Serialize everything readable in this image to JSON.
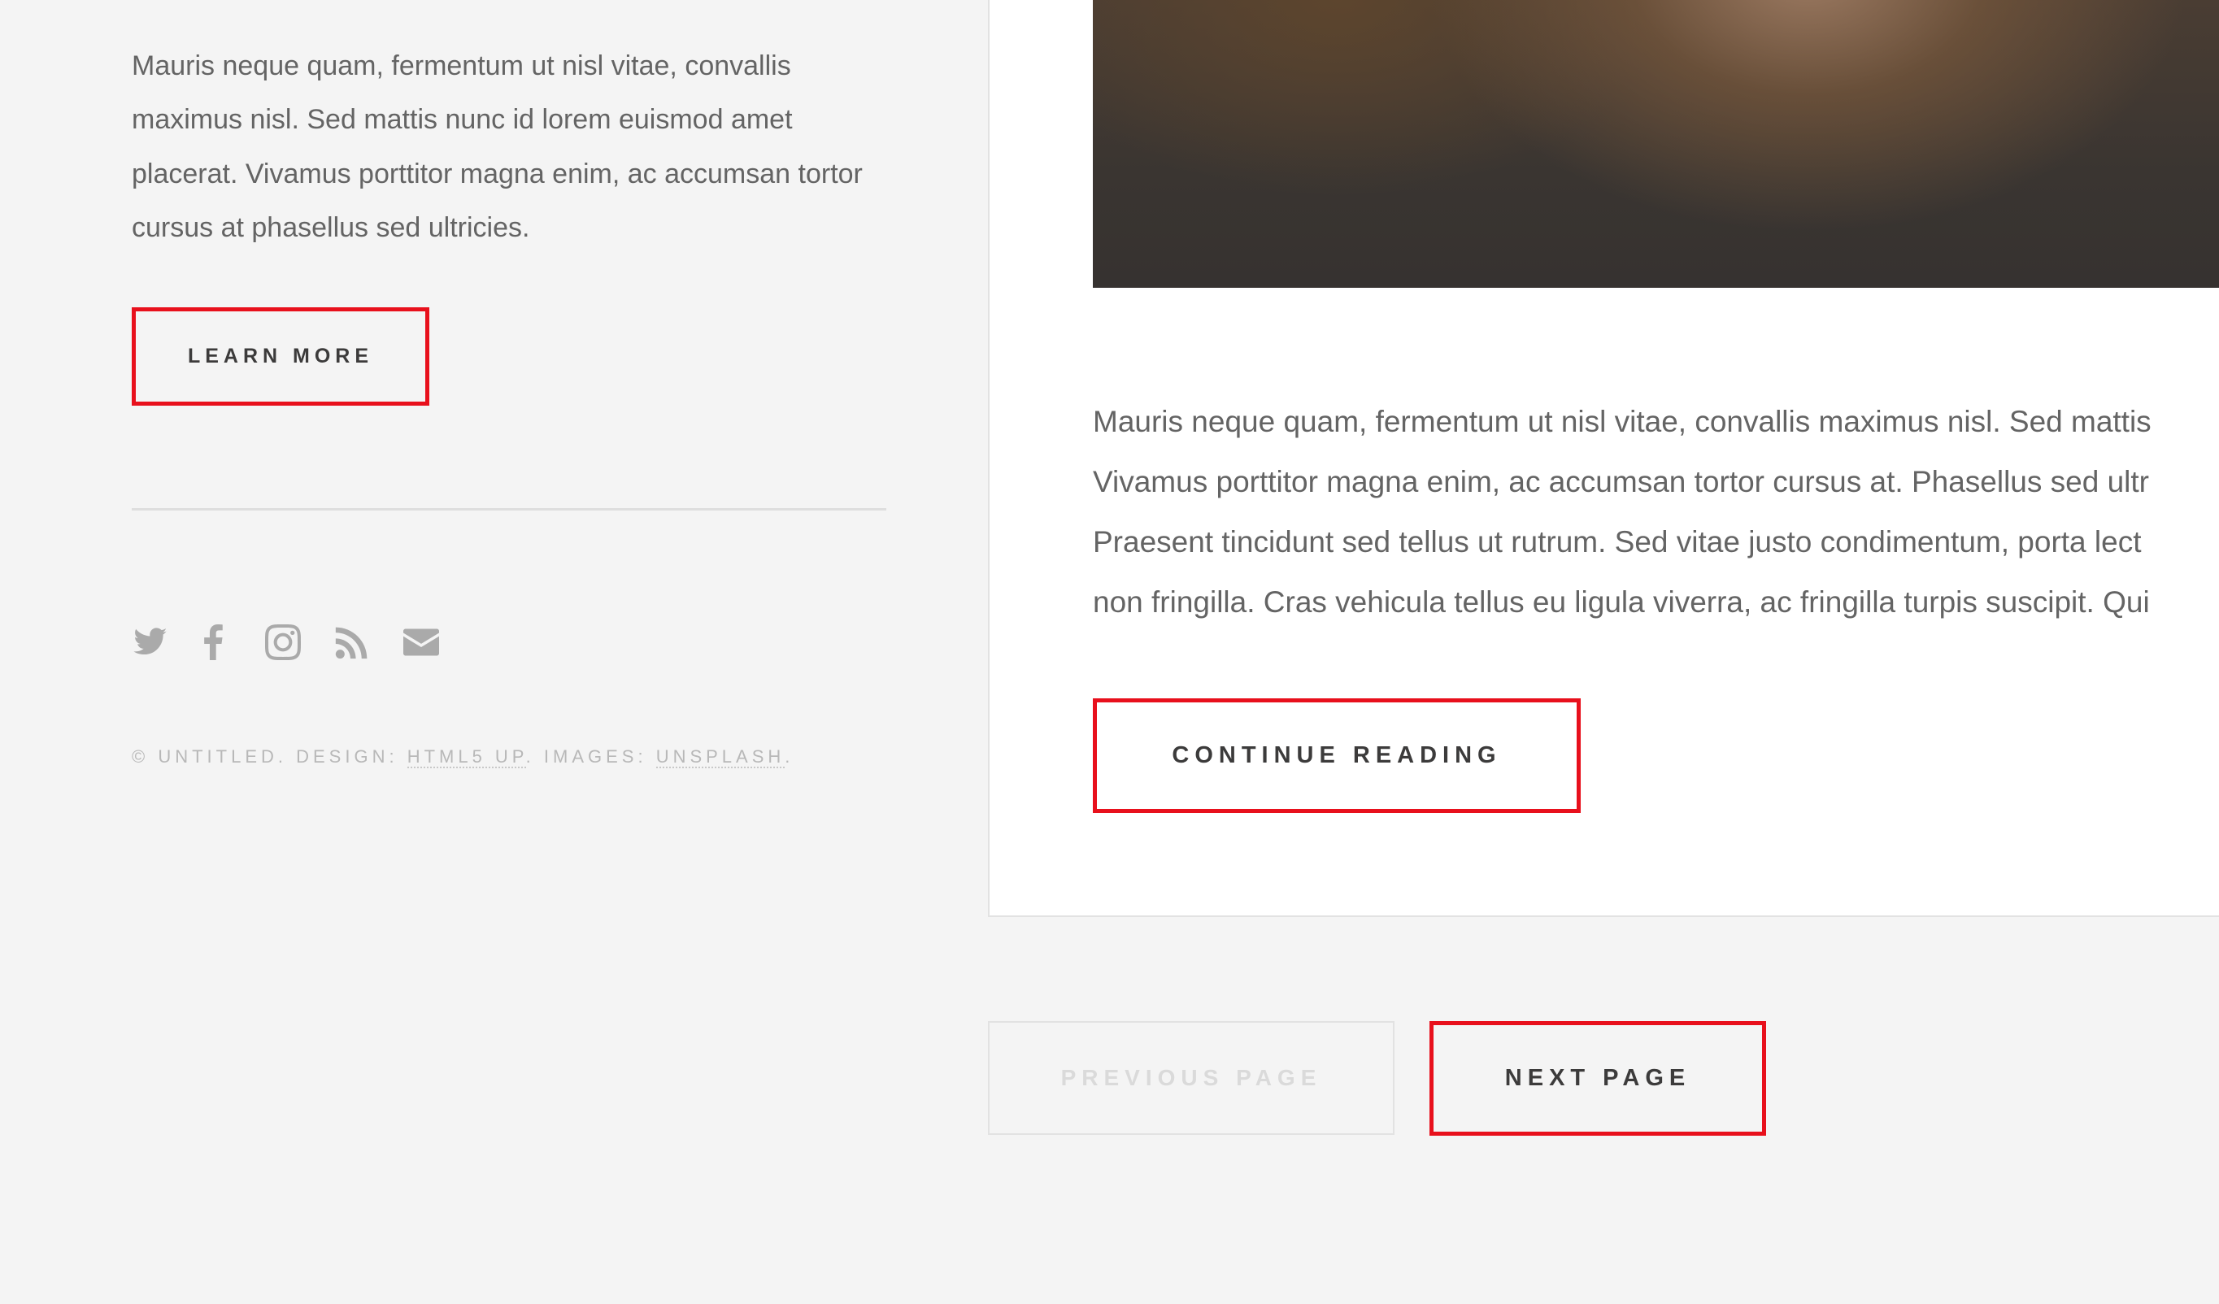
{
  "sidebar": {
    "intro_text": "Mauris neque quam, fermentum ut nisl vitae, convallis maximus nisl. Sed mattis nunc id lorem euismod amet placerat. Vivamus porttitor magna enim, ac accumsan tortor cursus at phasellus sed ultricies.",
    "learn_more_label": "LEARN MORE",
    "socials": [
      "twitter-icon",
      "facebook-icon",
      "instagram-icon",
      "rss-icon",
      "email-icon"
    ],
    "copyright": {
      "prefix": "© UNTITLED. DESIGN: ",
      "design_link": "HTML5 UP",
      "middle": ". IMAGES: ",
      "images_link": "UNSPLASH",
      "suffix": "."
    }
  },
  "post": {
    "lines": [
      "Mauris neque quam, fermentum ut nisl vitae, convallis maximus nisl. Sed mattis",
      "Vivamus porttitor magna enim, ac accumsan tortor cursus at. Phasellus sed ultr",
      "Praesent tincidunt sed tellus ut rutrum. Sed vitae justo condimentum, porta lect",
      "non fringilla. Cras vehicula tellus eu ligula viverra, ac fringilla turpis suscipit. Qui"
    ],
    "continue_label": "CONTINUE READING"
  },
  "pagination": {
    "previous_label": "PREVIOUS PAGE",
    "next_label": "NEXT PAGE"
  },
  "colors": {
    "highlight_border": "#e8101c",
    "background": "#f4f4f4",
    "card": "#ffffff"
  }
}
